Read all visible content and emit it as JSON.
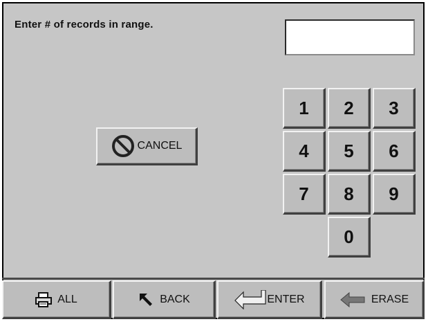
{
  "prompt": "Enter # of records in range.",
  "entry": {
    "value": ""
  },
  "cancel": {
    "label": "CANCEL",
    "icon": "no-entry-icon"
  },
  "keypad": {
    "keys": [
      "1",
      "2",
      "3",
      "4",
      "5",
      "6",
      "7",
      "8",
      "9",
      "0"
    ]
  },
  "bottom_bar": {
    "all": {
      "label": "ALL",
      "icon": "printer-icon"
    },
    "back": {
      "label": "BACK",
      "icon": "back-arrow-icon"
    },
    "enter": {
      "label": "ENTER",
      "icon": "enter-arrow-icon"
    },
    "erase": {
      "label": "ERASE",
      "icon": "erase-arrow-icon"
    }
  }
}
